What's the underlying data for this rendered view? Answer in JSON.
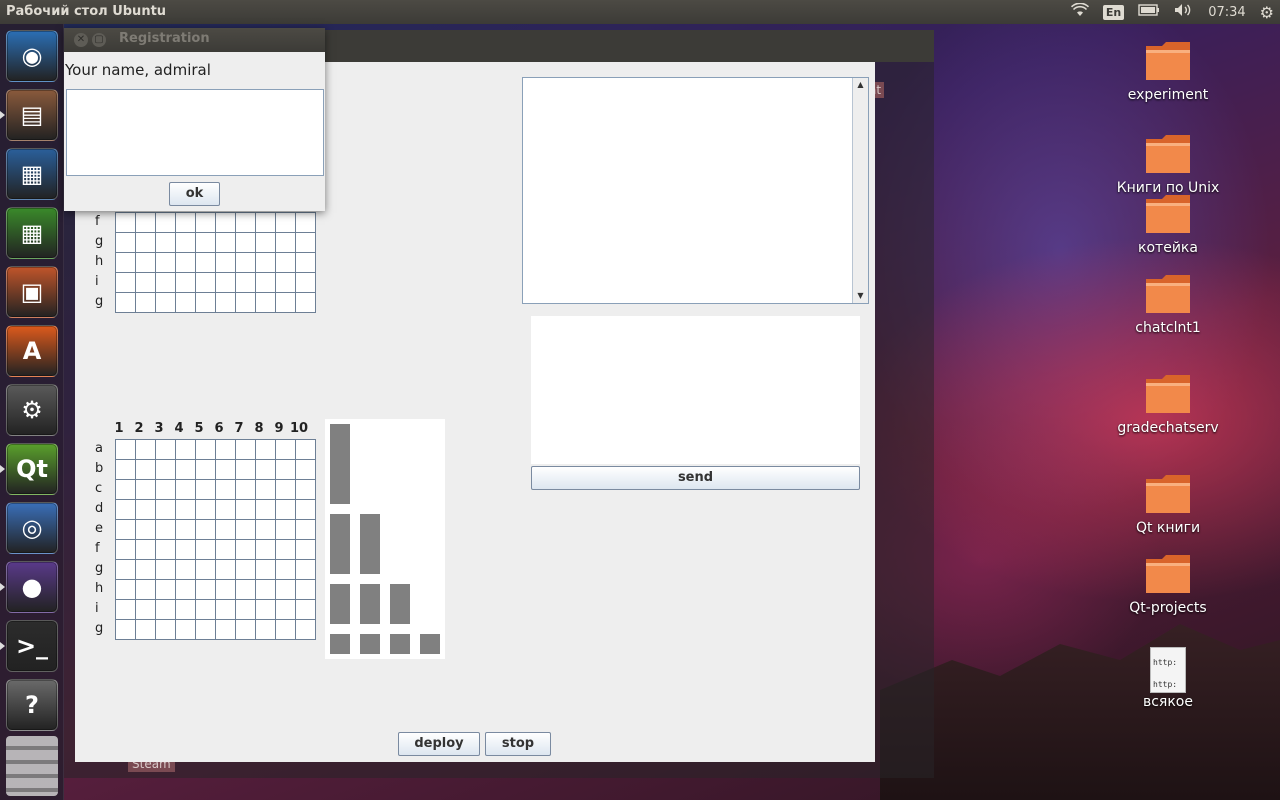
{
  "desktop": {
    "title": "Рабочий стол Ubuntu",
    "icons": [
      {
        "label": "experiment",
        "type": "folder"
      },
      {
        "label": "Книги по Unix",
        "type": "folder"
      },
      {
        "label": "котейка",
        "type": "folder"
      },
      {
        "label": "chatclnt1",
        "type": "folder"
      },
      {
        "label": "gradechatserv",
        "type": "folder"
      },
      {
        "label": "Qt книги",
        "type": "folder"
      },
      {
        "label": "Qt-projects",
        "type": "folder"
      },
      {
        "label": "всякое",
        "type": "file",
        "file_lines": [
          "http:",
          "http:"
        ]
      }
    ],
    "background_tags": {
      "chat": "at",
      "steam": "Steam"
    }
  },
  "top_panel": {
    "language": "En",
    "time": "07:34",
    "icons": [
      "wifi-icon",
      "keyboard-layout-icon",
      "battery-icon",
      "volume-icon",
      "settings-gear-icon"
    ]
  },
  "launcher": [
    {
      "name": "ubuntu-dash-icon",
      "glyph": "◉",
      "color": "#2b6fb5"
    },
    {
      "name": "files-icon",
      "glyph": "▤",
      "color": "#8a5a3c"
    },
    {
      "name": "libreoffice-writer-icon",
      "glyph": "▦",
      "color": "#2a5f9a"
    },
    {
      "name": "libreoffice-calc-icon",
      "glyph": "▦",
      "color": "#3a8a2a"
    },
    {
      "name": "libreoffice-impress-icon",
      "glyph": "▣",
      "color": "#c0552a"
    },
    {
      "name": "software-center-icon",
      "glyph": "A",
      "color": "#dd5a1c"
    },
    {
      "name": "system-settings-icon",
      "glyph": "⚙",
      "color": "#5a5a5a"
    },
    {
      "name": "qt-creator-icon",
      "glyph": "Qt",
      "color": "#5aa02c"
    },
    {
      "name": "chromium-icon",
      "glyph": "◎",
      "color": "#3a6fb8"
    },
    {
      "name": "eclipse-icon",
      "glyph": "●",
      "color": "#5a3a8a"
    },
    {
      "name": "terminal-icon",
      "glyph": ">_",
      "color": "#2c2c2c"
    },
    {
      "name": "help-icon",
      "glyph": "?",
      "color": "#6a6a6a"
    }
  ],
  "registration": {
    "title": "Registration",
    "prompt": "Your name, admiral",
    "name_value": "",
    "ok_label": "ok"
  },
  "game": {
    "column_labels": [
      "1",
      "2",
      "3",
      "4",
      "5",
      "6",
      "7",
      "8",
      "9",
      "10"
    ],
    "row_labels": [
      "a",
      "b",
      "c",
      "d",
      "e",
      "f",
      "g",
      "h",
      "i",
      "g"
    ],
    "top_board_visible_row_labels": [
      "f",
      "g",
      "h",
      "i",
      "g"
    ],
    "ships": [
      {
        "size": 4,
        "count": 1
      },
      {
        "size": 3,
        "count": 2
      },
      {
        "size": 2,
        "count": 3
      },
      {
        "size": 1,
        "count": 4
      }
    ],
    "chat_log": "",
    "message_value": "",
    "send_label": "send",
    "deploy_label": "deploy",
    "stop_label": "stop"
  }
}
